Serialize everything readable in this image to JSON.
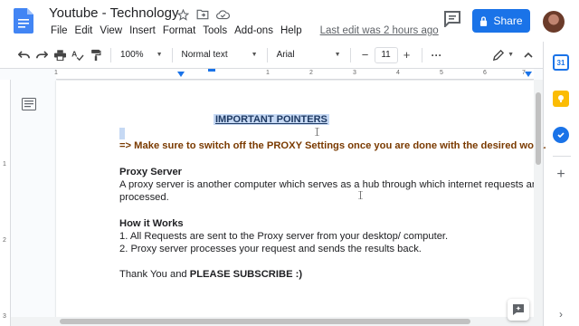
{
  "header": {
    "title": "Youtube - Technology",
    "menu": [
      "File",
      "Edit",
      "View",
      "Insert",
      "Format",
      "Tools",
      "Add-ons",
      "Help"
    ],
    "last_edit": "Last edit was 2 hours ago",
    "share_label": "Share"
  },
  "toolbar": {
    "zoom": "100%",
    "style": "Normal text",
    "font": "Arial",
    "font_size": "11",
    "minus": "−",
    "plus": "+",
    "more": "···"
  },
  "ruler": {
    "h_numbers": [
      "1",
      "1",
      "2",
      "3",
      "4",
      "5",
      "6",
      "7"
    ],
    "v_numbers": [
      "1",
      "2",
      "3"
    ]
  },
  "document": {
    "heading": "IMPORTANT POINTERS",
    "warning": "=> Make sure to switch off the PROXY Settings once you are done with the desired work.",
    "proxy_title": "Proxy Server",
    "proxy_line1": "A proxy server is another computer which serves as a hub through which internet requests are",
    "proxy_line2": "processed.",
    "how_title": "How it Works",
    "how_line1": "1. All Requests are sent to the Proxy server from your desktop/ computer.",
    "how_line2": "2. Proxy server processes your request and sends the results back.",
    "thanks_prefix": "Thank You and ",
    "thanks_bold": "PLEASE SUBSCRIBE :)"
  },
  "side_panel": {
    "calendar_label": "31"
  },
  "colors": {
    "accent": "#1a73e8",
    "selection": "#c6d9f4",
    "warning_text": "#7a3a00"
  }
}
